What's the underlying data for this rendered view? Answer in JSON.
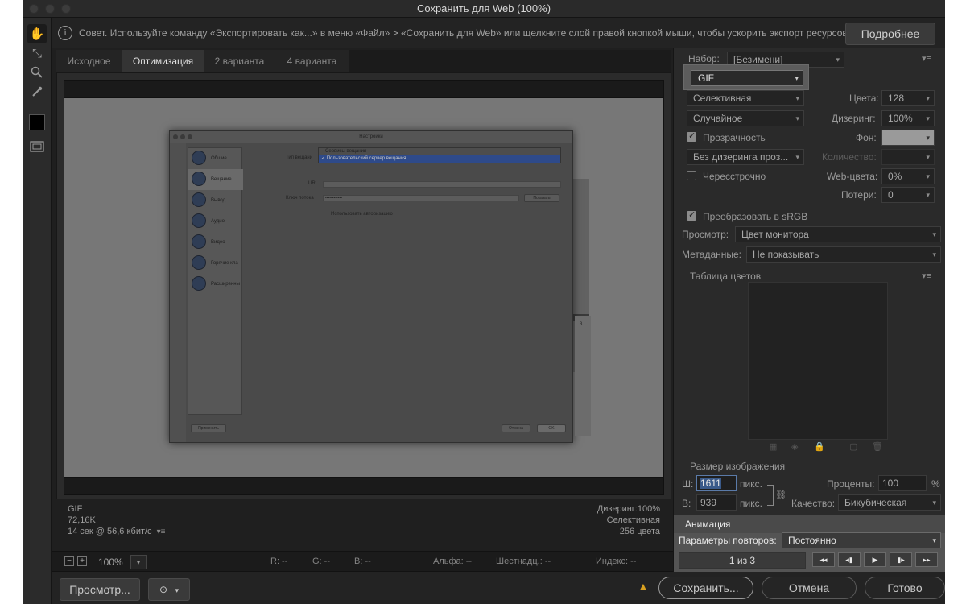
{
  "window": {
    "title": "Сохранить для Web (100%)"
  },
  "tip": {
    "text": "Совет. Используйте команду «Экспортировать как...» в меню «Файл» > «Сохранить для Web» или щелкните слой правой кнопкой мыши, чтобы ускорить экспорт ресурсов",
    "more_label": "Подробнее"
  },
  "tabs": [
    "Исходное",
    "Оптимизация",
    "2 варианта",
    "4 варианта"
  ],
  "preview": {
    "dialog_title": "Настройки",
    "categories": [
      "Общие",
      "Вещание",
      "Вывод",
      "Аудио",
      "Видео",
      "Горячие кла",
      "Расширенны"
    ],
    "stream_type_label": "Тип вещани",
    "menu_item_1": "Сервисы вещания",
    "menu_item_2": "✓ Пользовательский сервер вещания",
    "url_label": "URL",
    "key_label": "Ключ потока",
    "key_value": "••••••••••••",
    "show_button": "Показать",
    "use_auth": "Использовать авторизацию",
    "apply_button": "Применить",
    "cancel_button": "Отмена",
    "ok_button": "OK",
    "side_digit": "3"
  },
  "status": {
    "format": "GIF",
    "size": "72,16K",
    "time": "14 сек @ 56,6 кбит/с",
    "dither": "Дизеринг:100%",
    "palette": "Селективная",
    "colors": "256 цвета"
  },
  "info": {
    "zoom": "100%",
    "r": "R: --",
    "g": "G: --",
    "b": "B: --",
    "alpha": "Альфа: --",
    "hex": "Шестнадц.: --",
    "index": "Индекс: --"
  },
  "buttons": {
    "preview": "Просмотр...",
    "save": "Сохранить...",
    "cancel": "Отмена",
    "done": "Готово"
  },
  "panel": {
    "preset_label": "Набор:",
    "preset_value": "[Безимени]",
    "format_value": "GIF",
    "reduction": "Селективная",
    "colors_label": "Цвета:",
    "colors_value": "128",
    "dither_algo": "Случайное",
    "dither_label": "Дизеринг:",
    "dither_value": "100%",
    "transparency": "Прозрачность",
    "matte_label": "Фон:",
    "trans_dither": "Без дизеринга проз...",
    "amount_label": "Количество:",
    "interlaced": "Чересстрочно",
    "websnap_label": "Web-цвета:",
    "websnap_value": "0%",
    "lossy_label": "Потери:",
    "lossy_value": "0",
    "convert_srgb": "Преобразовать в sRGB",
    "preview_label": "Просмотр:",
    "preview_value": "Цвет монитора",
    "metadata_label": "Метаданные:",
    "metadata_value": "Не показывать",
    "color_table": "Таблица цветов",
    "image_size": "Размер изображения",
    "w_label": "Ш:",
    "w_value": "1611",
    "h_label": "В:",
    "h_value": "939",
    "px": "пикс.",
    "percent_label": "Проценты:",
    "percent_value": "100",
    "percent_sign": "%",
    "quality_label": "Качество:",
    "quality_value": "Бикубическая"
  },
  "animation": {
    "title": "Анимация",
    "loop_label": "Параметры повторов:",
    "loop_value": "Постоянно",
    "frame_counter": "1 из 3"
  },
  "colors": {
    "window_bg": "#1f1f1f",
    "panel_bg": "#2a2a2a",
    "canvas_bg": "#777777",
    "warning": "#d8a020"
  }
}
